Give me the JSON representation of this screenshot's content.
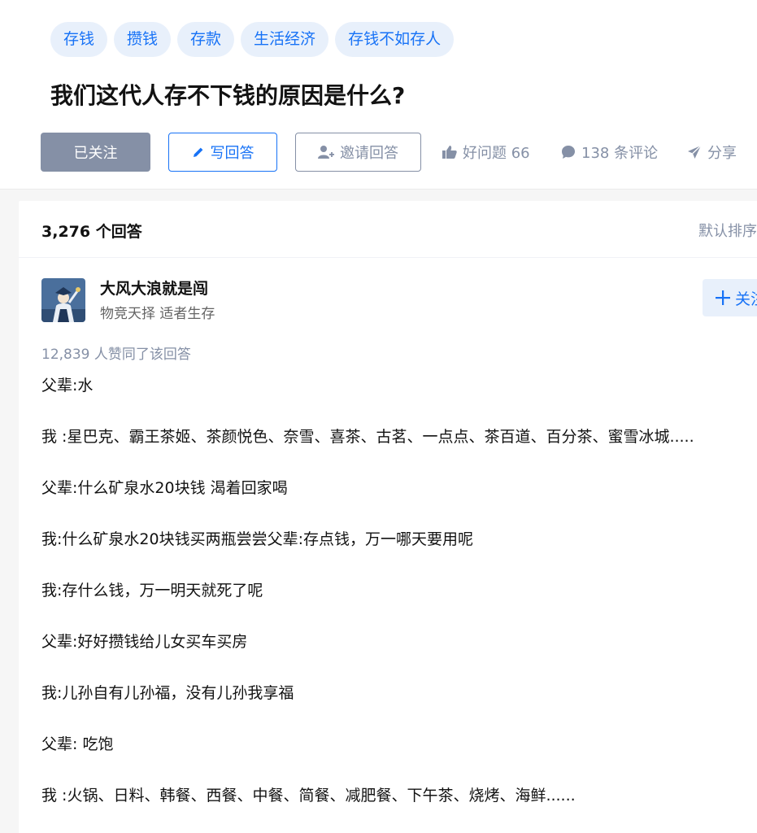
{
  "question": {
    "tags": [
      "存钱",
      "攒钱",
      "存款",
      "生活经济",
      "存钱不如存人"
    ],
    "title": "我们这代人存不下钱的原因是什么?",
    "follow_label": "已关注",
    "write_label": "写回答",
    "invite_label": "邀请回答",
    "like_label": "好问题 66",
    "comment_label": "138 条评论",
    "share_label": "分享"
  },
  "answers": {
    "count_label": "3,276 个回答",
    "sort_label": "默认排序"
  },
  "answer": {
    "author_name": "大风大浪就是闯",
    "author_bio": "物竞天择 适者生存",
    "follow_label": "关注",
    "votes_label": "12,839 人赞同了该回答",
    "paragraphs": [
      "父辈:水",
      "我 :星巴克、霸王茶姬、茶颜悦色、奈雪、喜茶、古茗、一点点、茶百道、百分茶、蜜雪冰城.....",
      "父辈:什么矿泉水20块钱 渴着回家喝",
      "我:什么矿泉水20块钱买两瓶尝尝父辈:存点钱，万一哪天要用呢",
      "我:存什么钱，万一明天就死了呢",
      "父辈:好好攒钱给儿女买车买房",
      "我:儿孙自有儿孙福，没有儿孙我享福",
      "父辈: 吃饱",
      "我 :火锅、日料、韩餐、西餐、中餐、简餐、减肥餐、下午茶、烧烤、海鲜......"
    ]
  },
  "colors": {
    "accent": "#1772f6",
    "tag_bg": "#e8f0fb",
    "muted": "#8590a6",
    "followed_bg": "#8590a6"
  },
  "icons": [
    "pencil-icon",
    "invite-user-icon",
    "thumbs-up-icon",
    "comment-icon",
    "paper-plane-icon",
    "plus-icon"
  ]
}
